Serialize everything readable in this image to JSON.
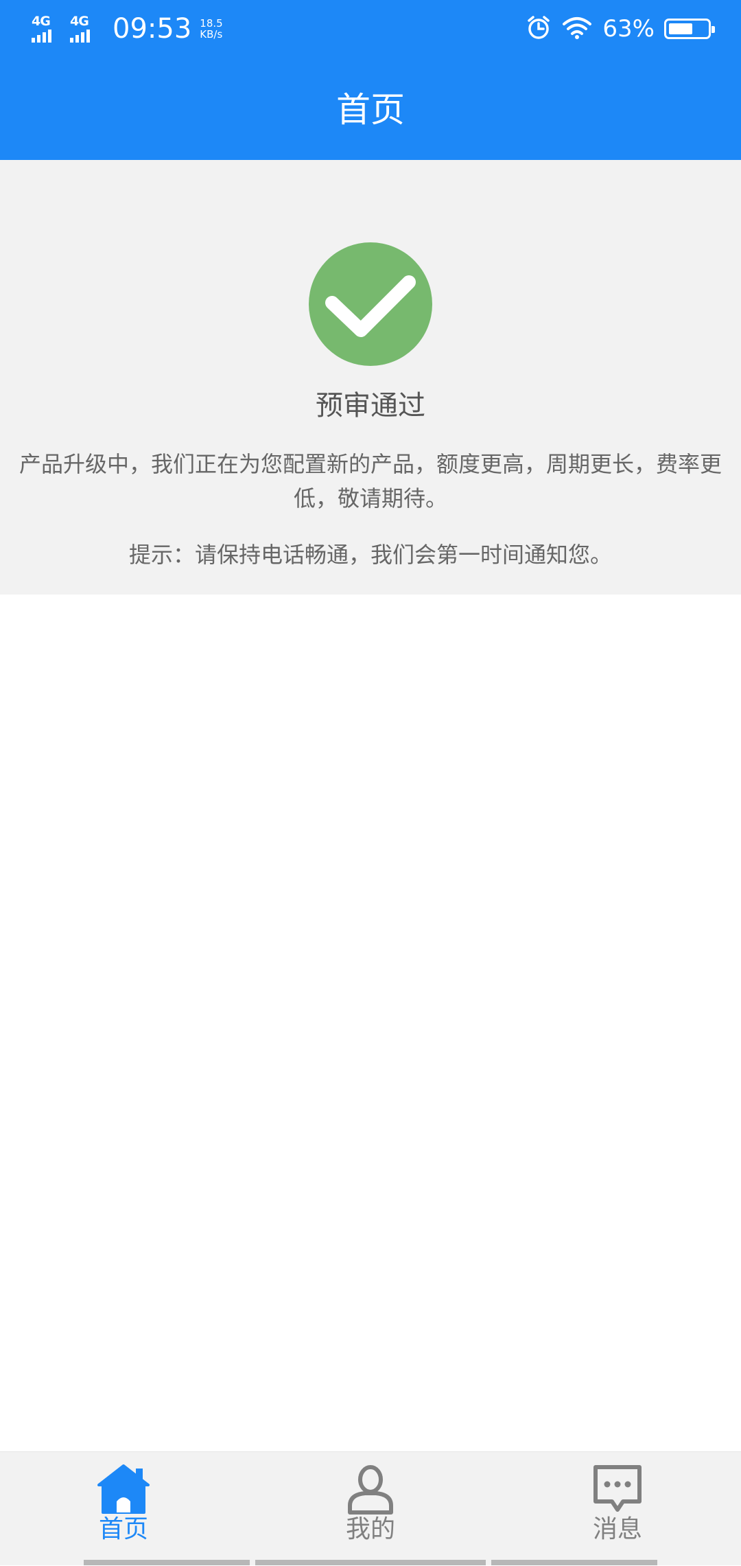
{
  "status_bar": {
    "signal1": "4G",
    "signal2": "4G",
    "time": "09:53",
    "net_speed_value": "18.5",
    "net_speed_unit": "KB/s",
    "battery_percent": "63%",
    "battery_level": 0.63,
    "icons": [
      "alarm-icon",
      "wifi-icon",
      "battery-icon"
    ]
  },
  "header": {
    "title": "首页"
  },
  "status_panel": {
    "icon": "check-circle-icon",
    "title": "预审通过",
    "description": "产品升级中，我们正在为您配置新的产品，额度更高，周期更长，费率更低，敬请期待。",
    "tip": "提示：请保持电话畅通，我们会第一时间通知您。"
  },
  "bottom_nav": {
    "items": [
      {
        "label": "首页",
        "icon": "home-icon",
        "active": true
      },
      {
        "label": "我的",
        "icon": "user-icon",
        "active": false
      },
      {
        "label": "消息",
        "icon": "message-icon",
        "active": false
      }
    ]
  },
  "colors": {
    "primary": "#1d88f7",
    "success": "#77b96e",
    "panel_bg": "#f2f2f2",
    "inactive": "#808080"
  }
}
